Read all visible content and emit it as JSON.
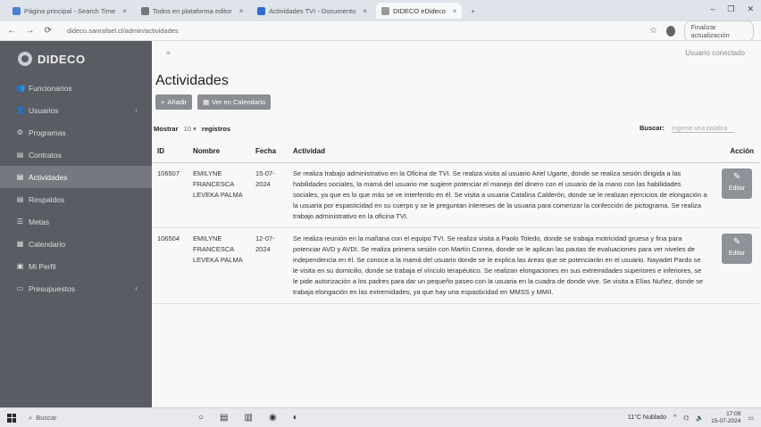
{
  "browser": {
    "tabs": [
      {
        "label": "Página principal - Search Time",
        "fav": "#4a7fd6"
      },
      {
        "label": "Todos en plataforma editor",
        "fav": "#777"
      },
      {
        "label": "Actividades TVI - Documento",
        "fav": "#2d6fd1"
      },
      {
        "label": "DIDECO eDideco",
        "fav": "#999"
      }
    ],
    "url": "dideco.sanrafael.cl/admin/actividades",
    "update_label": "Finalizar actualización"
  },
  "sidebar": {
    "brand": "DIDECO",
    "items": [
      {
        "label": "Funcionarios",
        "icon": "users-icon",
        "glyph": "👥"
      },
      {
        "label": "Usuarios",
        "icon": "user-icon",
        "glyph": "👤",
        "chevron": "‹"
      },
      {
        "label": "Programas",
        "icon": "gear-icon",
        "glyph": "⚙"
      },
      {
        "label": "Contratos",
        "icon": "document-icon",
        "glyph": "▤"
      },
      {
        "label": "Actividades",
        "icon": "document-icon",
        "glyph": "▤",
        "active": true
      },
      {
        "label": "Respaldos",
        "icon": "document-icon",
        "glyph": "▤"
      },
      {
        "label": "Metas",
        "icon": "list-icon",
        "glyph": "☰"
      },
      {
        "label": "Calendario",
        "icon": "calendar-icon",
        "glyph": "▦"
      },
      {
        "label": "Mi Perfil",
        "icon": "id-card-icon",
        "glyph": "▣"
      },
      {
        "label": "Presupuestos",
        "icon": "money-icon",
        "glyph": "▭",
        "chevron": "‹"
      }
    ]
  },
  "main": {
    "menu_glyph": "≡",
    "user_label": "Usuario conectado",
    "title": "Actividades",
    "add_label": "Añadir",
    "calendar_label": "Ver en Calendario",
    "show_label": "Mostrar",
    "show_value": "10",
    "records_label": "registros",
    "search_label": "Buscar:",
    "search_placeholder": "Ingrese una palabra",
    "columns": [
      "ID",
      "Nombre",
      "Fecha",
      "Actividad",
      "Acción"
    ],
    "rows": [
      {
        "id": "106507",
        "name": "EMILYNE FRANCESCA LEVEKA PALMA",
        "date": "15-07-2024",
        "activity": "Se realiza trabajo administrativo en la Oficina de TVI. Se realiza visita al usuario Ariel Ugarte, donde se realiza sesión dirigida a las habilidades sociales, la mamá del usuario me sugiere potenciar el manejo del dinero con el usuario de la mano con las habilidades sociales, ya que es lo que más se ve interferido en él. Se visita a usuaria Catalina Calderón, donde se le realizan ejercicios de elongación a la usuaria por espasticidad en su cuerpo y se le preguntan intereses de la usuaria para comenzar la confección de pictograma. Se realiza trabajo administrativo en la oficina TVI.",
        "edit_label": "Editar"
      },
      {
        "id": "106504",
        "name": "EMILYNE FRANCESCA LEVEKA PALMA",
        "date": "12-07-2024",
        "activity": "Se realiza reunión en la mañana con el equipo TVI. Se realiza visita a Paolo Toledo, donde se trabaja motricidad gruesa y fina para potenciar AVD y AVDI. Se realiza primera sesión con Martín Correa, donde se le aplican las pautas de evaluaciones para ver niveles de independencia en él. Se conoce a la mamá del usuario donde se le explica las áreas que se potenciarán en el usuario. Nayadet Pardo se le visita en su domicilio, donde se trabaja el vínculo terapéutico. Se realizan elongaciones en sus extremidades superiores e inferiores, se le pide autorización a los padres para dar un pequeño paseo con la usuaria en la cuadra de donde vive. Se visita a Elías Nuñez, donde se trabaja elongación en las extremidades, ya que hay una espasticidad en MMSS y MMII.",
        "edit_label": "Editar"
      }
    ]
  },
  "taskbar": {
    "search_label": "Buscar",
    "weather": "11°C Nublado",
    "time": "17:09",
    "date": "15-07-2024"
  }
}
